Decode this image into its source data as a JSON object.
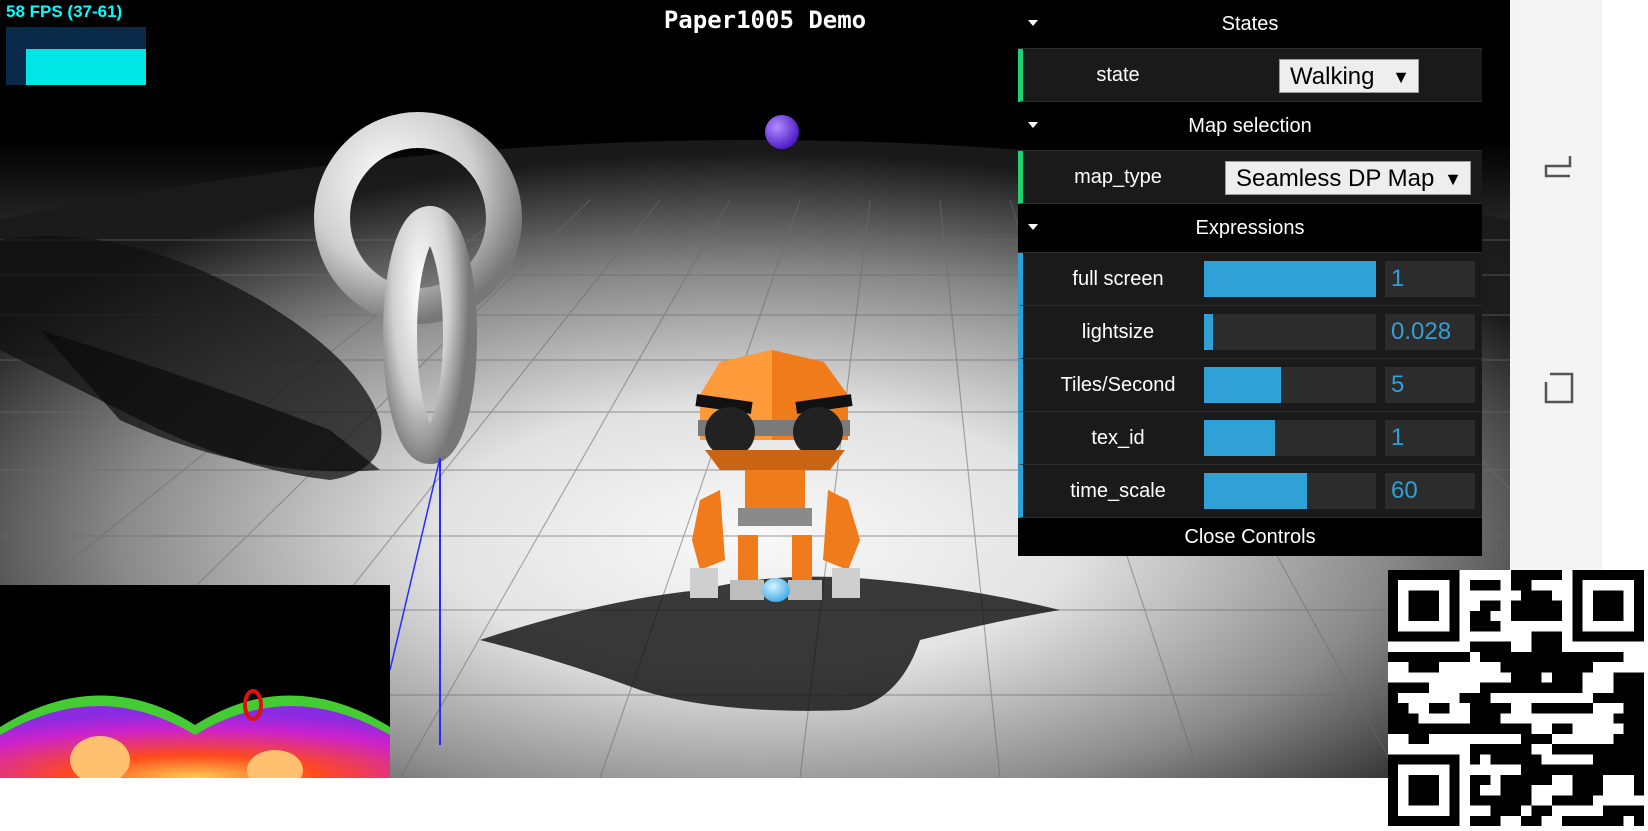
{
  "app": {
    "title": "Paper1005 Demo",
    "fps_label": "58 FPS (37-61)",
    "fps_level": 0.62
  },
  "gui": {
    "states": {
      "title": "States",
      "rows": [
        {
          "name": "state",
          "value": "Walking"
        }
      ]
    },
    "map_selection": {
      "title": "Map selection",
      "rows": [
        {
          "name": "map_type",
          "value": "Seamless DP Map"
        }
      ]
    },
    "expressions": {
      "title": "Expressions",
      "rows": [
        {
          "name": "full screen",
          "value": "1",
          "level": 1.0
        },
        {
          "name": "lightsize",
          "value": "0.028",
          "level": 0.05
        },
        {
          "name": "Tiles/Second",
          "value": "5",
          "level": 0.45
        },
        {
          "name": "tex_id",
          "value": "1",
          "level": 0.41
        },
        {
          "name": "time_scale",
          "value": "60",
          "level": 0.6
        }
      ]
    },
    "close_label": "Close Controls"
  },
  "colors": {
    "accent": "#2fa1d6",
    "select_accent": "#1ed36f",
    "fps": "#00e5e5",
    "robot": "#f07b1a"
  },
  "icons": {
    "nav_back": "back-arrow-icon",
    "nav_recent": "recent-apps-icon",
    "dropdown": "chevron-down-icon"
  }
}
